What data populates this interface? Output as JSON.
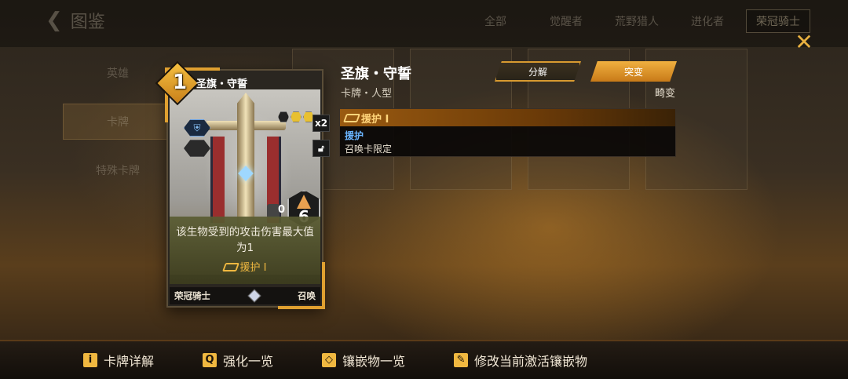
{
  "background": {
    "back_label": "图鉴",
    "tabs": [
      "全部",
      "觉醒者",
      "荒野猎人",
      "进化者",
      "荣冠骑士"
    ],
    "side": [
      "英雄",
      "卡牌",
      "特殊卡牌"
    ]
  },
  "card": {
    "cost": "1",
    "name": "圣旗・守誓",
    "copies": "x2",
    "shield": "0",
    "attack": "6",
    "description": "该生物受到的攻击伤害最大值为1",
    "keyword": "援护 I",
    "faction": "荣冠骑士",
    "card_type": "召唤"
  },
  "info": {
    "title": "圣旗・守誓",
    "subtitle": "卡牌・人型",
    "tag": "畸变",
    "dismantle_label": "分解",
    "mutate_label": "突变",
    "rule": {
      "header": "援护 I",
      "name": "援护",
      "text": "召唤卡限定"
    }
  },
  "bottom_bar": [
    {
      "icon": "info-icon",
      "glyph": "i",
      "label": "卡牌详解"
    },
    {
      "icon": "search-icon",
      "glyph": "Q",
      "label": "强化一览"
    },
    {
      "icon": "inlay-icon",
      "glyph": "◇",
      "label": "镶嵌物一览"
    },
    {
      "icon": "edit-icon",
      "glyph": "✎",
      "label": "修改当前激活镶嵌物"
    }
  ],
  "colors": {
    "accent": "#e8b040",
    "keyword": "#f0b840",
    "rule_name": "#6ab4ff"
  }
}
